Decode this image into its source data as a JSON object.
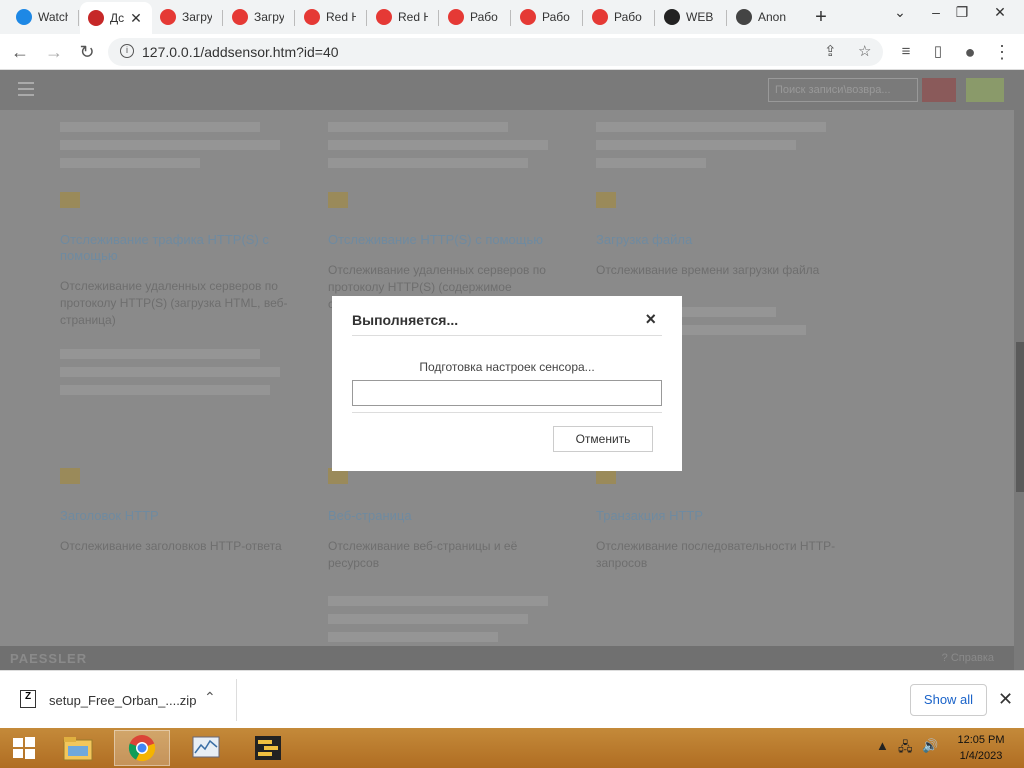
{
  "browser": {
    "tabs": [
      {
        "title": "Watch",
        "favicon": "youtube-icon",
        "color": "#1e88e5",
        "glyph": "▶"
      },
      {
        "title": "Дс",
        "favicon": "prtg-icon",
        "color": "#c62828",
        "glyph": "¹⁄₄",
        "active": true
      },
      {
        "title": "Загру",
        "favicon": "prtg-gauge-icon",
        "color": "#e53935",
        "glyph": ""
      },
      {
        "title": "Загру",
        "favicon": "prtg-gauge-icon",
        "color": "#e53935",
        "glyph": ""
      },
      {
        "title": "Red H",
        "favicon": "prtg-gauge-icon",
        "color": "#e53935",
        "glyph": ""
      },
      {
        "title": "Red H",
        "favicon": "prtg-gauge-icon",
        "color": "#e53935",
        "glyph": ""
      },
      {
        "title": "Рабо",
        "favicon": "prtg-gauge-icon",
        "color": "#e53935",
        "glyph": ""
      },
      {
        "title": "Рабо",
        "favicon": "prtg-gauge-icon",
        "color": "#e53935",
        "glyph": ""
      },
      {
        "title": "Рабо",
        "favicon": "prtg-gauge-icon",
        "color": "#e53935",
        "glyph": ""
      },
      {
        "title": "WEB",
        "favicon": "eye-icon",
        "color": "#222222",
        "glyph": ""
      },
      {
        "title": "Anon",
        "favicon": "triangle-icon",
        "color": "#444444",
        "glyph": ""
      }
    ],
    "new_tab": "+",
    "url": "127.0.0.1/addsensor.htm?id=40"
  },
  "page": {
    "search_placeholder": "Поиск записи\\возвра...",
    "cards": [
      {
        "title": "Отслеживание трафика HTTP(S) с помощью",
        "desc": "Отслеживание удаленных серверов по протоколу HTTP(S) (загрузка HTML, веб-страница)"
      },
      {
        "title": "Отслеживание HTTP(S) с помощью",
        "desc": "Отслеживание удаленных серверов по протоколу HTTP(S) (содержимое страницы)"
      },
      {
        "title": "Загрузка файла",
        "desc": "Отслеживание времени загрузки файла"
      },
      {
        "title": "Заголовок HTTP",
        "desc": "Отслеживание заголовков HTTP-ответа"
      },
      {
        "title": "Веб-страница",
        "desc": "Отслеживание веб-страницы и её ресурсов"
      },
      {
        "title": "Транзакция HTTP",
        "desc": "Отслеживание последовательности HTTP-запросов"
      }
    ],
    "brand": "PAESSLER",
    "help": "? Справка"
  },
  "modal": {
    "title": "Выполняется...",
    "close": "×",
    "message": "Подготовка настроек сенсора...",
    "progress": 0,
    "cancel": "Отменить"
  },
  "downloads": {
    "file": "setup_Free_Orban_....zip",
    "show_all": "Show all"
  },
  "taskbar": {
    "time": "12:05 PM",
    "date": "1/4/2023"
  }
}
